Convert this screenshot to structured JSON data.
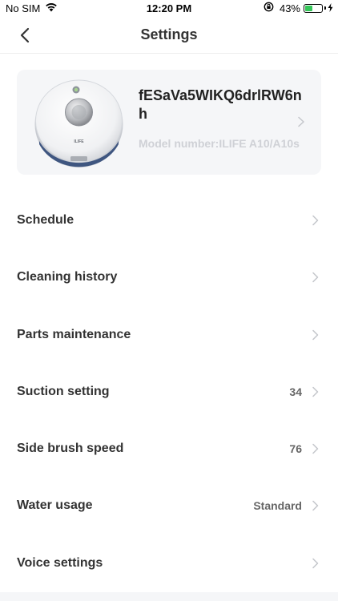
{
  "status_bar": {
    "carrier": "No SIM",
    "time": "12:20 PM",
    "battery_percent": "43%",
    "battery_level": 0.43,
    "battery_color": "#35c759"
  },
  "nav": {
    "title": "Settings",
    "back_icon": "chevron-left-icon"
  },
  "device": {
    "name": "fESaVa5WIKQ6drlRW6nh",
    "model": "Model number:ILIFE A10/A10s",
    "brand_on_image": "ILIFE"
  },
  "settings": [
    {
      "label": "Schedule",
      "value": ""
    },
    {
      "label": "Cleaning history",
      "value": ""
    },
    {
      "label": "Parts maintenance",
      "value": ""
    },
    {
      "label": "Suction setting",
      "value": "34"
    },
    {
      "label": "Side brush speed",
      "value": "76"
    },
    {
      "label": "Water usage",
      "value": "Standard"
    },
    {
      "label": "Voice settings",
      "value": ""
    }
  ]
}
